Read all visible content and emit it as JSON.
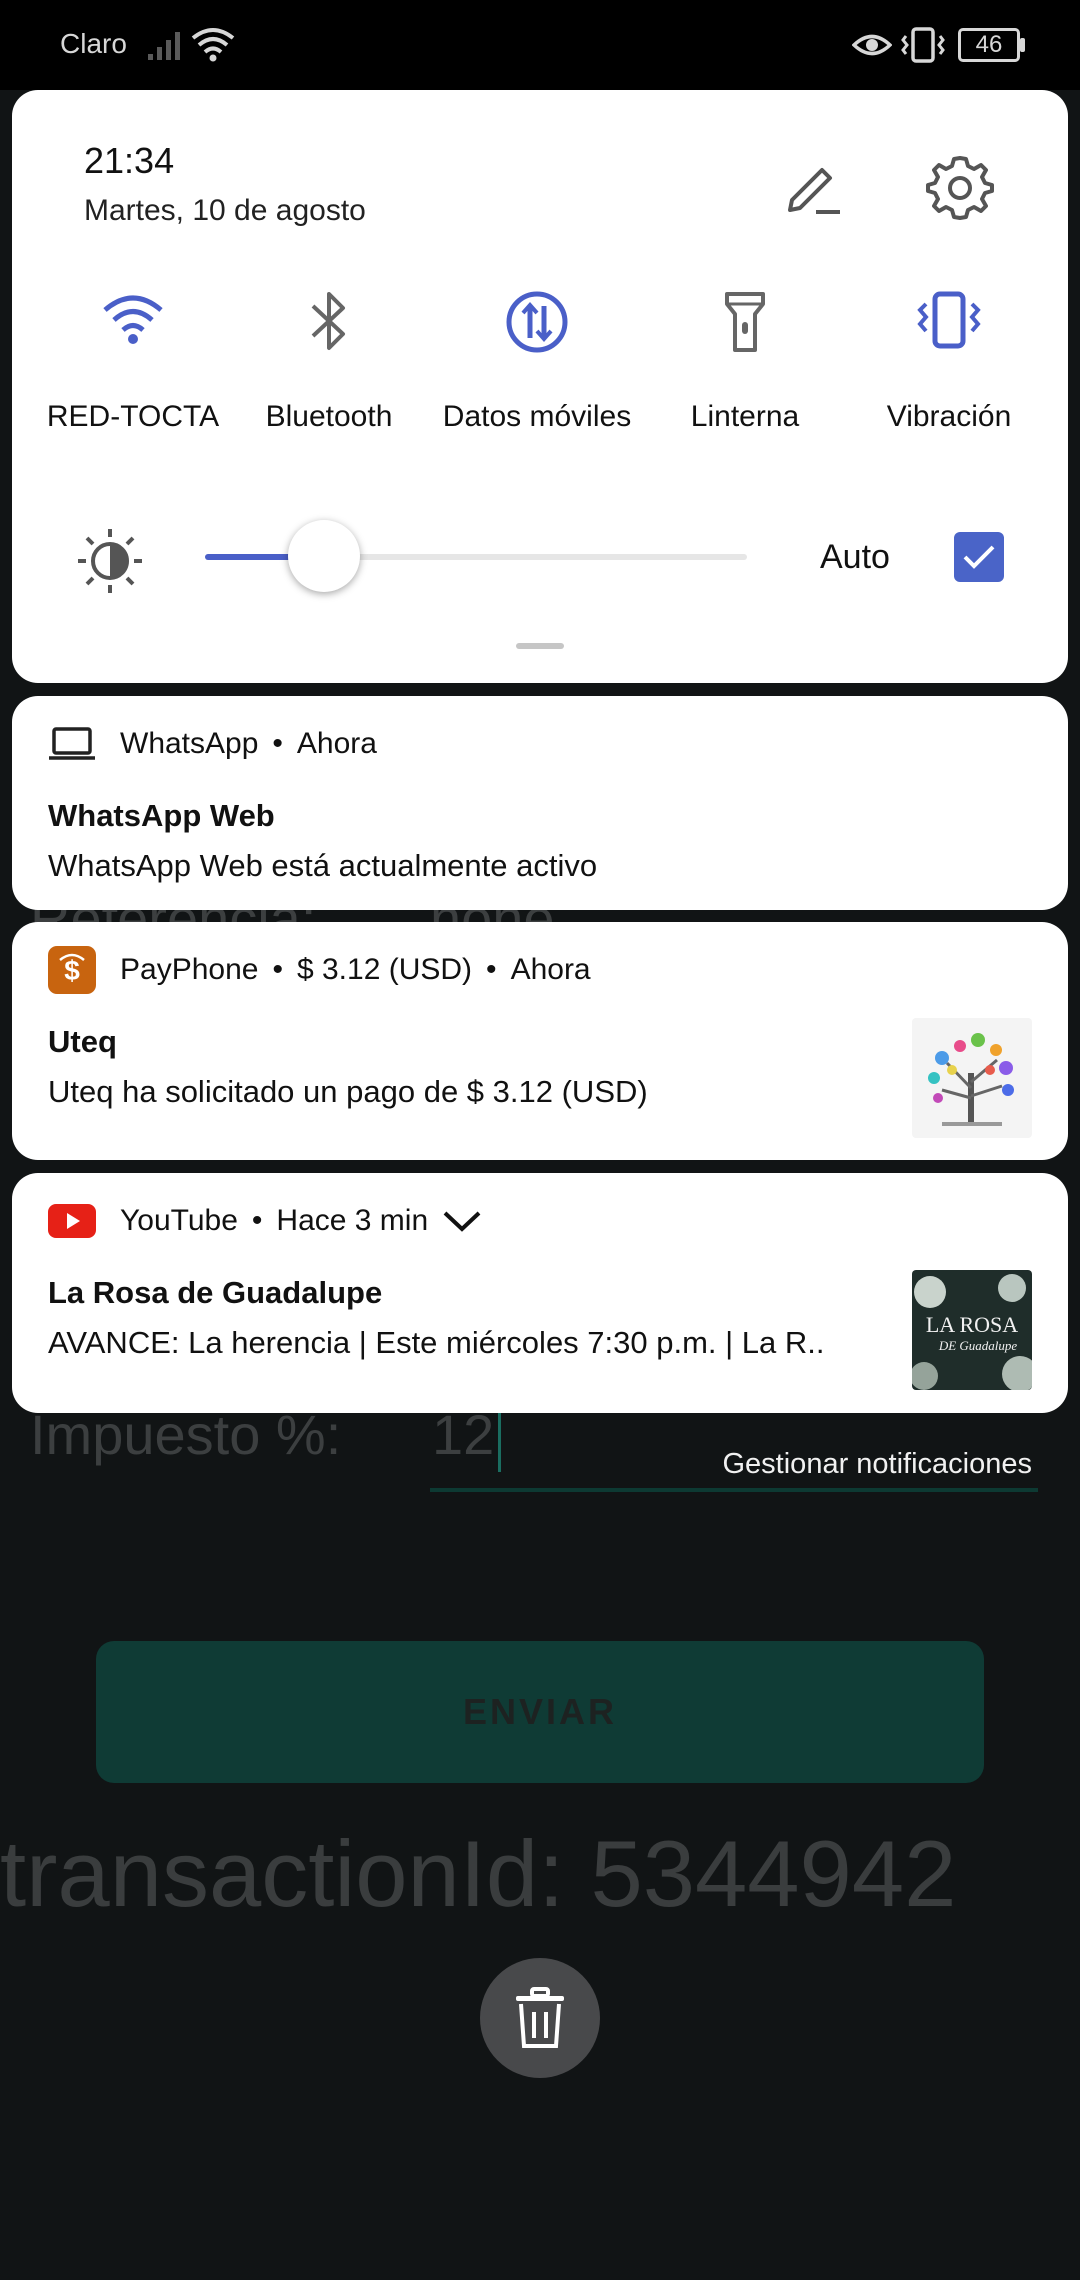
{
  "status_bar": {
    "carrier": "Claro",
    "battery": "46",
    "icons": [
      "signal-icon",
      "wifi-icon",
      "eye-comfort-icon",
      "vibrate-icon",
      "battery-icon"
    ]
  },
  "quick_settings": {
    "time": "21:34",
    "date": "Martes, 10 de agosto",
    "tiles": [
      {
        "label": "RED-TOCTA",
        "icon": "wifi-icon",
        "active": true
      },
      {
        "label": "Bluetooth",
        "icon": "bluetooth-icon",
        "active": false
      },
      {
        "label": "Datos móviles",
        "icon": "mobile-data-icon",
        "active": true
      },
      {
        "label": "Linterna",
        "icon": "flashlight-icon",
        "active": false
      },
      {
        "label": "Vibración",
        "icon": "vibration-icon",
        "active": true
      }
    ],
    "brightness": {
      "level": 0.22,
      "auto_label": "Auto",
      "auto_checked": true
    },
    "accent": "#4a5fc8"
  },
  "notifications": [
    {
      "app": "WhatsApp",
      "time": "Ahora",
      "title": "WhatsApp Web",
      "body": "WhatsApp Web está actualmente activo",
      "icon": "laptop-icon"
    },
    {
      "app": "PayPhone",
      "amount": "$ 3.12 (USD)",
      "time": "Ahora",
      "title": "Uteq",
      "body": "Uteq ha solicitado un pago de $ 3.12 (USD)",
      "icon": "payphone-icon"
    },
    {
      "app": "YouTube",
      "time": "Hace 3 min",
      "title": "La Rosa de Guadalupe",
      "body": "AVANCE: La herencia | Este miércoles 7:30 p.m. | La R..",
      "icon": "youtube-icon",
      "thumb_text_1": "LA ROSA",
      "thumb_text_2": "DE Guadalupe"
    }
  ],
  "manage_label": "Gestionar notificaciones",
  "background_app": {
    "referencia_label": "Referencia:",
    "referencia_value": "none",
    "impuesto_label": "Impuesto %:",
    "impuesto_value": "12",
    "send_button": "ENVIAR",
    "transaction": "transactionId: 5344942"
  }
}
